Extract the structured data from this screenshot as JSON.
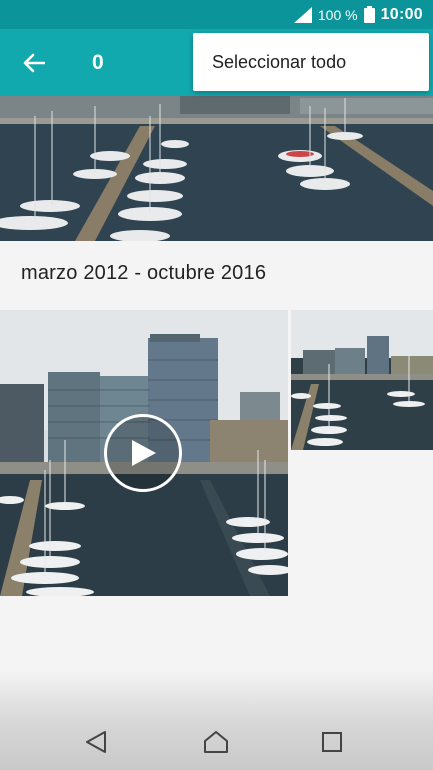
{
  "status_bar": {
    "battery_percent": "100 %",
    "time": "10:00",
    "icons": [
      "signal-icon",
      "battery-icon"
    ]
  },
  "toolbar": {
    "back_icon": "arrow-back-icon",
    "selected_count": "0"
  },
  "overflow_menu": {
    "items": [
      {
        "label": "Seleccionar todo"
      }
    ]
  },
  "gallery": {
    "section_header": "marzo 2012 - octubre 2016",
    "items": [
      {
        "kind": "video",
        "play_icon": "play-icon"
      },
      {
        "kind": "photo"
      }
    ]
  },
  "nav_bar": {
    "buttons": [
      "nav-back-icon",
      "nav-home-icon",
      "nav-recents-icon"
    ]
  },
  "colors": {
    "status_bar": "#0b959a",
    "toolbar": "#11a9ae",
    "menu_bg": "#ffffff",
    "background": "#f4f4f4"
  }
}
